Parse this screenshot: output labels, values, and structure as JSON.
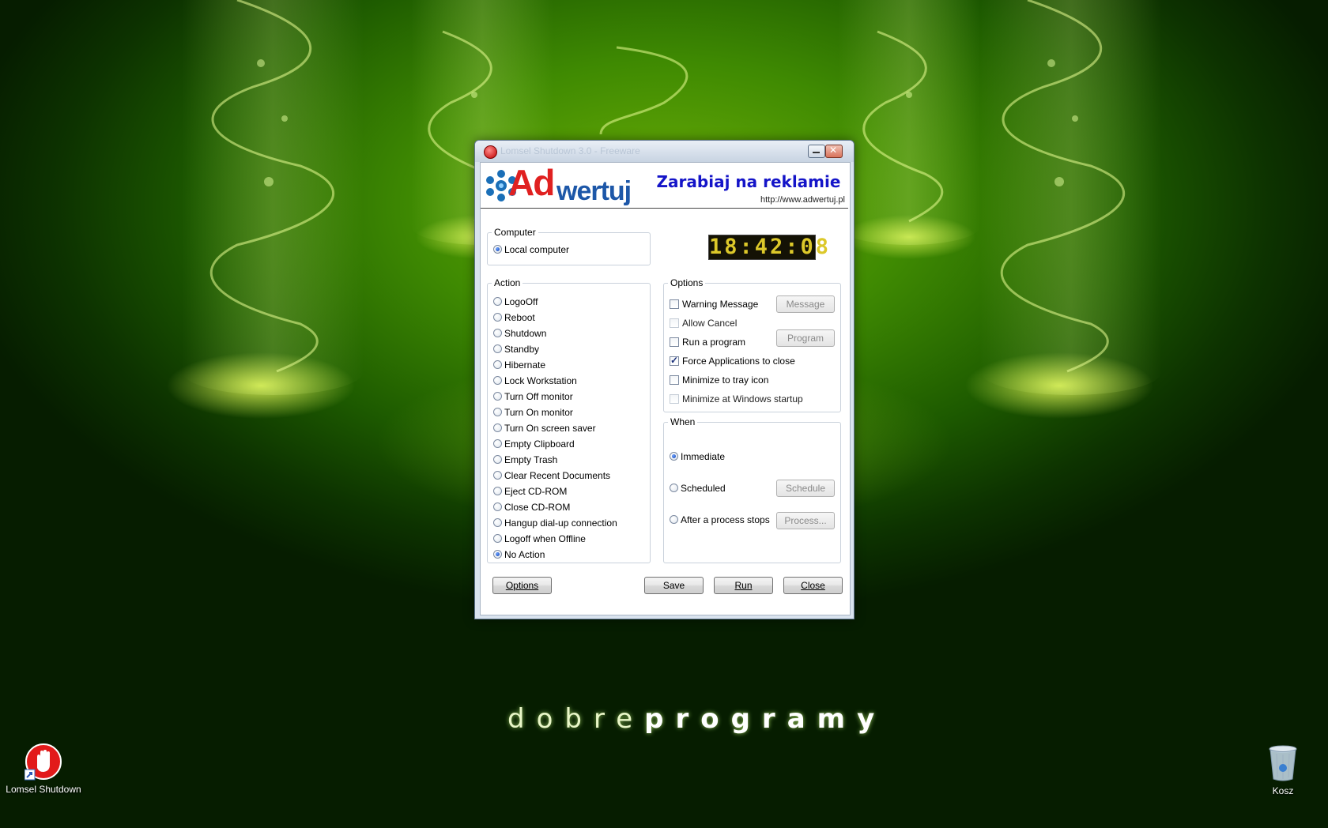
{
  "desktop": {
    "brand_light": "dobre",
    "brand_bold": "programy",
    "icons": [
      {
        "label": "Lomsel Shutdown",
        "icon": "stop-hand-icon"
      },
      {
        "label": "Kosz",
        "icon": "recycle-bin-icon"
      }
    ]
  },
  "window": {
    "title": "Lomsel Shutdown 3.0 - Freeware",
    "banner": {
      "logo_ad": "Ad",
      "logo_rest": "wertuj",
      "slogan": "Zarabiaj na reklamie",
      "url": "http://www.adwertuj.pl"
    },
    "clock": "18:42:08",
    "computer": {
      "legend": "Computer",
      "options": [
        {
          "label": "Local computer",
          "checked": true
        }
      ]
    },
    "action": {
      "legend": "Action",
      "items": [
        {
          "label": "LogoOff",
          "checked": false
        },
        {
          "label": "Reboot",
          "checked": false
        },
        {
          "label": "Shutdown",
          "checked": false
        },
        {
          "label": "Standby",
          "checked": false
        },
        {
          "label": "Hibernate",
          "checked": false
        },
        {
          "label": "Lock Workstation",
          "checked": false
        },
        {
          "label": "Turn Off monitor",
          "checked": false
        },
        {
          "label": "Turn On monitor",
          "checked": false
        },
        {
          "label": "Turn On screen saver",
          "checked": false
        },
        {
          "label": "Empty Clipboard",
          "checked": false
        },
        {
          "label": "Empty Trash",
          "checked": false
        },
        {
          "label": "Clear Recent Documents",
          "checked": false
        },
        {
          "label": "Eject CD-ROM",
          "checked": false
        },
        {
          "label": "Close CD-ROM",
          "checked": false
        },
        {
          "label": "Hangup dial-up connection",
          "checked": false
        },
        {
          "label": "Logoff when Offline",
          "checked": false
        },
        {
          "label": "No Action",
          "checked": true
        }
      ]
    },
    "options": {
      "legend": "Options",
      "items": [
        {
          "label": "Warning Message",
          "checked": false,
          "enabled": true
        },
        {
          "label": "Allow Cancel",
          "checked": false,
          "enabled": false
        },
        {
          "label": "Run a program",
          "checked": false,
          "enabled": true
        },
        {
          "label": "Force Applications to close",
          "checked": true,
          "enabled": true
        },
        {
          "label": "Minimize to tray icon",
          "checked": false,
          "enabled": true
        },
        {
          "label": "Minimize at Windows startup",
          "checked": false,
          "enabled": false
        }
      ],
      "message_button": "Message",
      "program_button": "Program"
    },
    "when": {
      "legend": "When",
      "items": [
        {
          "label": "Immediate",
          "checked": true
        },
        {
          "label": "Scheduled",
          "checked": false
        },
        {
          "label": "After a process stops",
          "checked": false
        }
      ],
      "schedule_button": "Schedule",
      "process_button": "Process..."
    },
    "buttons": {
      "options": "Options",
      "save": "Save",
      "run": "Run",
      "close": "Close"
    }
  }
}
